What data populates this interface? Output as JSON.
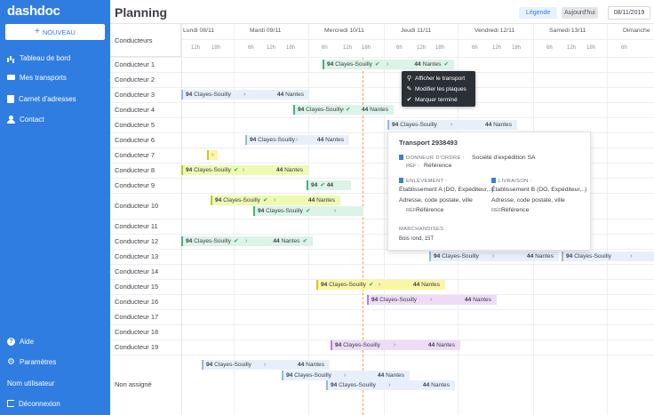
{
  "sidebar": {
    "logo": "dashdoc",
    "new_button": "NOUVEAU",
    "nav": [
      {
        "label": "Tableau de bord",
        "icon": "dashboard-icon"
      },
      {
        "label": "Mes transports",
        "icon": "truck-icon"
      },
      {
        "label": "Carnet d'adresses",
        "icon": "address-book-icon"
      },
      {
        "label": "Contact",
        "icon": "contact-icon"
      }
    ],
    "bottom": {
      "help": "Aide",
      "settings": "Paramètres",
      "username": "Nom utilisateur",
      "logout": "Déconnexion"
    }
  },
  "topbar": {
    "title": "Planning",
    "legend": "Légende",
    "today": "Aujourd'hui",
    "date": "08/11/2019"
  },
  "grid": {
    "driver_header": "Conducteurs",
    "days": [
      "Lundi 08/11",
      "Mardi 09/11",
      "Mercredi 10/11",
      "Jeudi 11/11",
      "Vendredi 12/11",
      "Samedi 13/11",
      "Dimanche"
    ],
    "hours": [
      "12h",
      "18h",
      "6h",
      "12h",
      "18h",
      "6h",
      "12h",
      "18h",
      "6h",
      "12h",
      "18h",
      "6h",
      "12h",
      "18h",
      "6h",
      "12h",
      "18h",
      "6h"
    ],
    "drivers": [
      "Conducteur 1",
      "Conducteur 2",
      "Conducteur 3",
      "Conducteur 4",
      "Conducteur 5",
      "Conducteur 6",
      "Conducteur 7",
      "Conducteur 8",
      "Conducteur 9",
      "Conducteur 10",
      "Conducteur 11",
      "Conducteur 12",
      "Conducteur 13",
      "Conducteur 14",
      "Conducteur 15",
      "Conducteur 16",
      "Conducteur 17",
      "Conducteur 18",
      "Conducteur 19",
      "Non assigné"
    ]
  },
  "transports": {
    "origin_num": "94",
    "origin_name": "Clayes-Souilly",
    "dest_num": "44",
    "dest_name": "Nantes",
    "dest_short": "44",
    "colors": {
      "planned": "#e7f0fa",
      "done": "#dcf3e7",
      "loading": "#eefab0",
      "ongoing": "#fbf6a6",
      "other": "#eedcf7"
    }
  },
  "context_menu": {
    "items": [
      {
        "label": "Afficher le transport",
        "icon": "search-icon"
      },
      {
        "label": "Modifier les plaques",
        "icon": "pencil-icon"
      },
      {
        "label": "Marquer terminé",
        "icon": "check-icon"
      }
    ]
  },
  "popover": {
    "title": "Transport 2938493",
    "shipper_label": "DONNEUR D'ORDRE :",
    "shipper_value": "Société d'expédition SA",
    "ref_label": "RÉF :",
    "ref_value": "Référence",
    "pickup_label": "ENLÈVEMENT :",
    "pickup_value": "Établissement A (DO, Expéditeur,..)",
    "pickup_address": "Adresse, code postale, ville",
    "delivery_label": "LIVRAISON :",
    "delivery_value": "Établissement B (DO, Expéditeur,..)",
    "delivery_address": "Adresse, code postale, ville",
    "goods_label": "MARCHANDISES :",
    "goods_value": "Bois rond, 15T"
  }
}
